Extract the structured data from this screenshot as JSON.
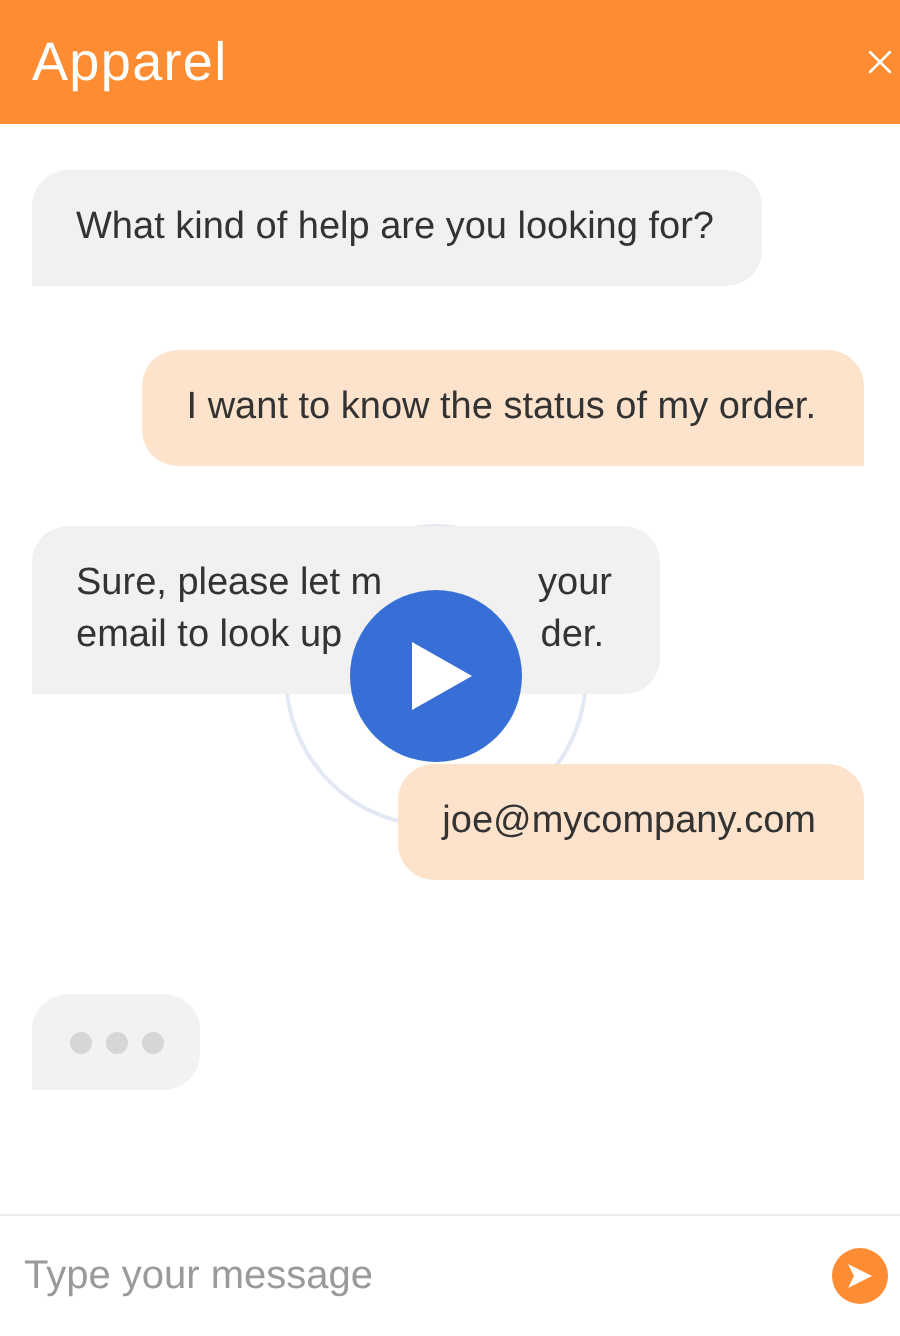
{
  "header": {
    "title": "Apparel"
  },
  "messages": [
    {
      "kind": "bot",
      "lines": [
        [
          "What kind of help are you looking for?"
        ]
      ]
    },
    {
      "kind": "user",
      "lines": [
        [
          "I want to know the status of my order."
        ]
      ]
    },
    {
      "kind": "bot",
      "lines": [
        [
          "Sure, please let m",
          "your"
        ],
        [
          "email to look up",
          "der."
        ]
      ]
    },
    {
      "kind": "user",
      "lines": [
        [
          "joe@mycompany.com"
        ]
      ]
    },
    {
      "kind": "typing"
    }
  ],
  "composer": {
    "placeholder": "Type your message"
  }
}
